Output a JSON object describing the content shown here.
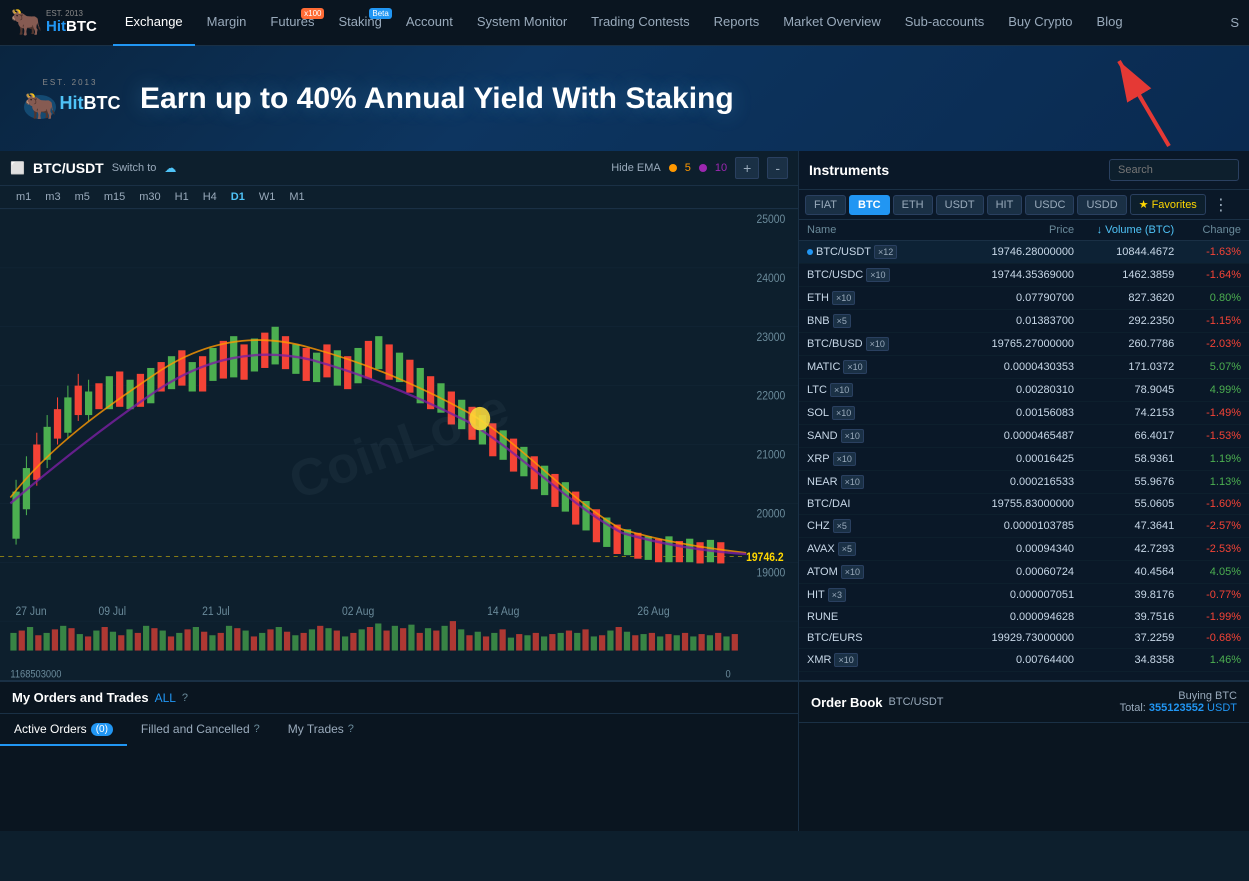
{
  "app": {
    "title": "HitBTC",
    "est": "EST. 2013"
  },
  "nav": {
    "items": [
      {
        "label": "Exchange",
        "active": true,
        "badge": null
      },
      {
        "label": "Margin",
        "active": false,
        "badge": null
      },
      {
        "label": "Futures",
        "active": false,
        "badge": "x100"
      },
      {
        "label": "Staking",
        "active": false,
        "badge": "Beta"
      },
      {
        "label": "Account",
        "active": false,
        "badge": null
      },
      {
        "label": "System Monitor",
        "active": false,
        "badge": null
      },
      {
        "label": "Trading Contests",
        "active": false,
        "badge": null
      },
      {
        "label": "Reports",
        "active": false,
        "badge": null
      },
      {
        "label": "Market Overview",
        "active": false,
        "badge": null
      },
      {
        "label": "Sub-accounts",
        "active": false,
        "badge": null
      },
      {
        "label": "Buy Crypto",
        "active": false,
        "badge": null
      },
      {
        "label": "Blog",
        "active": false,
        "badge": null
      }
    ],
    "right_item": "S"
  },
  "banner": {
    "text": "Earn up to 40% Annual Yield With Staking"
  },
  "chart": {
    "symbol": "BTC/USDT",
    "switch_to_label": "Switch to",
    "ema_label": "Hide EMA",
    "ema5": "5",
    "ema10": "10",
    "timeframes": [
      "m1",
      "m3",
      "m5",
      "m15",
      "m30",
      "H1",
      "H4",
      "D1",
      "W1",
      "M1"
    ],
    "active_tf": "D1",
    "price_current": "19746.2",
    "dates": [
      "27 Jun",
      "09 Jul",
      "21 Jul",
      "02 Aug",
      "14 Aug",
      "26 Aug"
    ],
    "price_levels": [
      "25000",
      "24000",
      "23000",
      "22000",
      "21000",
      "20000",
      "19000"
    ],
    "volume_label": "1168503000",
    "zoom_plus": "+",
    "zoom_minus": "-"
  },
  "instruments": {
    "title": "Instruments",
    "search_placeholder": "Search",
    "tabs": [
      "FIAT",
      "BTC",
      "ETH",
      "USDT",
      "HIT",
      "USDC",
      "USDD",
      "★ Favorites"
    ],
    "active_tab": "BTC",
    "columns": [
      "Name",
      "Price",
      "↓ Volume (BTC)",
      "Change"
    ],
    "rows": [
      {
        "name": "BTC/USDT",
        "badge": "×12",
        "price": "19746.28000000",
        "volume": "10844.4672",
        "change": "-1.63%",
        "positive": false,
        "active": true
      },
      {
        "name": "BTC/USDC",
        "badge": "×10",
        "price": "19744.35369000",
        "volume": "1462.3859",
        "change": "-1.64%",
        "positive": false
      },
      {
        "name": "ETH",
        "badge": "×10",
        "price": "0.07790700",
        "volume": "827.3620",
        "change": "0.80%",
        "positive": true
      },
      {
        "name": "BNB",
        "badge": "×5",
        "price": "0.01383700",
        "volume": "292.2350",
        "change": "-1.15%",
        "positive": false
      },
      {
        "name": "BTC/BUSD",
        "badge": "×10",
        "price": "19765.27000000",
        "volume": "260.7786",
        "change": "-2.03%",
        "positive": false
      },
      {
        "name": "MATIC",
        "badge": "×10",
        "price": "0.0000430353",
        "volume": "171.0372",
        "change": "5.07%",
        "positive": true
      },
      {
        "name": "LTC",
        "badge": "×10",
        "price": "0.00280310",
        "volume": "78.9045",
        "change": "4.99%",
        "positive": true
      },
      {
        "name": "SOL",
        "badge": "×10",
        "price": "0.00156083",
        "volume": "74.2153",
        "change": "-1.49%",
        "positive": false
      },
      {
        "name": "SAND",
        "badge": "×10",
        "price": "0.0000465487",
        "volume": "66.4017",
        "change": "-1.53%",
        "positive": false
      },
      {
        "name": "XRP",
        "badge": "×10",
        "price": "0.00016425",
        "volume": "58.9361",
        "change": "1.19%",
        "positive": true
      },
      {
        "name": "NEAR",
        "badge": "×10",
        "price": "0.000216533",
        "volume": "55.9676",
        "change": "1.13%",
        "positive": true
      },
      {
        "name": "BTC/DAI",
        "badge": null,
        "price": "19755.83000000",
        "volume": "55.0605",
        "change": "-1.60%",
        "positive": false
      },
      {
        "name": "CHZ",
        "badge": "×5",
        "price": "0.0000103785",
        "volume": "47.3641",
        "change": "-2.57%",
        "positive": false
      },
      {
        "name": "AVAX",
        "badge": "×5",
        "price": "0.00094340",
        "volume": "42.7293",
        "change": "-2.53%",
        "positive": false
      },
      {
        "name": "ATOM",
        "badge": "×10",
        "price": "0.00060724",
        "volume": "40.4564",
        "change": "4.05%",
        "positive": true
      },
      {
        "name": "HIT",
        "badge": "×3",
        "price": "0.000007051",
        "volume": "39.8176",
        "change": "-0.77%",
        "positive": false
      },
      {
        "name": "RUNE",
        "badge": null,
        "price": "0.000094628",
        "volume": "39.7516",
        "change": "-1.99%",
        "positive": false
      },
      {
        "name": "BTC/EURS",
        "badge": null,
        "price": "19929.73000000",
        "volume": "37.2259",
        "change": "-0.68%",
        "positive": false
      },
      {
        "name": "XMR",
        "badge": "×10",
        "price": "0.00764400",
        "volume": "34.8358",
        "change": "1.46%",
        "positive": true
      }
    ]
  },
  "orders": {
    "title": "My Orders and Trades",
    "subtitle": "ALL",
    "tabs": [
      {
        "label": "Active Orders",
        "badge": "0",
        "active": true
      },
      {
        "label": "Filled and Cancelled",
        "badge": null,
        "active": false
      },
      {
        "label": "My Trades",
        "badge": null,
        "active": false
      }
    ]
  },
  "orderbook": {
    "title": "Order Book",
    "symbol": "BTC/USDT",
    "buying_label": "Buying BTC",
    "total_label": "Total:",
    "total_value": "355123552",
    "total_currency": "USDT"
  }
}
